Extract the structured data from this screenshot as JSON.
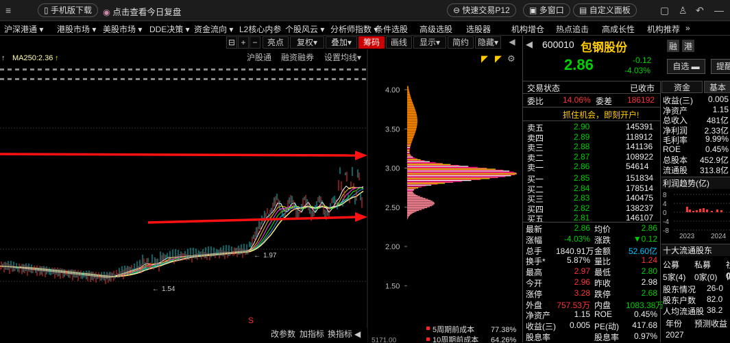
{
  "topbar": {
    "mobile_download": "手机版下载",
    "daily_review": "点击查看今日复盘",
    "quick_trade": "快速交易P12",
    "multi_window": "多窗口",
    "custom_panel": "自定义面板"
  },
  "menu": [
    "沪深港通",
    "港股市场",
    "美股市场",
    "DDE决策",
    "资金流向",
    "L2核心内参",
    "个股风云",
    "分析师指数",
    "条件选股",
    "高级选股",
    "选股器",
    "机构增仓",
    "热点追击",
    "高成长性",
    "机构推荐"
  ],
  "toolbar": {
    "buttons": [
      "亮点",
      "复权",
      "叠加",
      "筹码",
      "画线",
      "显示",
      "简约",
      "隐藏"
    ],
    "active": "筹码"
  },
  "chart": {
    "ma_label": "MA250:2.36",
    "sub_labels": [
      "沪股通",
      "融资融券",
      "设置均线"
    ],
    "price_ticks": [
      "4.00",
      "3.50",
      "3.00",
      "2.50",
      "2.00",
      "1.50"
    ],
    "min_label": "1.54",
    "mid_label": "1.97",
    "bottom_buttons": [
      "改参数",
      "加指标",
      "换指标"
    ],
    "volume_label": "5171.00",
    "cost_legend": [
      {
        "label": "5周期前成本",
        "value": "77.38%"
      },
      {
        "label": "10周期前成本",
        "value": "64.26%"
      }
    ],
    "annotation_color": "#ff1111"
  },
  "stock": {
    "code": "600010",
    "name": "包钢股份",
    "tags": [
      "融",
      "港"
    ],
    "price": "2.86",
    "change": "-0.12",
    "change_pct": "-4.03%",
    "watch_btn": "自选",
    "remind_btn": "提醒",
    "status_label": "交易状态",
    "status_value": "已收市",
    "wb_label": "委比",
    "wb_value": "14.06%",
    "wc_label": "委差",
    "wc_value": "186192",
    "ad_text": "抓住机会，即刻开户!",
    "asks": [
      {
        "label": "卖五",
        "price": "2.90",
        "vol": "145391"
      },
      {
        "label": "卖四",
        "price": "2.89",
        "vol": "118912"
      },
      {
        "label": "卖三",
        "price": "2.88",
        "vol": "141136"
      },
      {
        "label": "卖二",
        "price": "2.87",
        "vol": "108922"
      },
      {
        "label": "卖一",
        "price": "2.86",
        "vol": "54614"
      }
    ],
    "bids": [
      {
        "label": "买一",
        "price": "2.85",
        "vol": "151834"
      },
      {
        "label": "买二",
        "price": "2.84",
        "vol": "178514"
      },
      {
        "label": "买三",
        "price": "2.83",
        "vol": "140475"
      },
      {
        "label": "买四",
        "price": "2.82",
        "vol": "138237"
      },
      {
        "label": "买五",
        "price": "2.81",
        "vol": "146107"
      }
    ],
    "stats": [
      {
        "l1": "最新",
        "v1": "2.86",
        "c1": "green",
        "l2": "均价",
        "v2": "2.86",
        "c2": "green"
      },
      {
        "l1": "涨幅",
        "v1": "-4.03%",
        "c1": "green",
        "l2": "涨跌",
        "v2": "▼0.12",
        "c2": "green"
      },
      {
        "l1": "总手",
        "v1": "1840.91万",
        "c1": "white",
        "l2": "金额",
        "v2": "52.60亿",
        "c2": "cyan"
      },
      {
        "l1": "换手*",
        "v1": "5.87%",
        "c1": "white",
        "l2": "量比",
        "v2": "1.24",
        "c2": "red"
      },
      {
        "l1": "最高",
        "v1": "2.97",
        "c1": "red",
        "l2": "最低",
        "v2": "2.80",
        "c2": "green"
      },
      {
        "l1": "今开",
        "v1": "2.96",
        "c1": "red",
        "l2": "昨收",
        "v2": "2.98",
        "c2": "white"
      },
      {
        "l1": "涨停",
        "v1": "3.28",
        "c1": "red",
        "l2": "跌停",
        "v2": "2.68",
        "c2": "green"
      },
      {
        "l1": "外盘",
        "v1": "757.53万",
        "c1": "red",
        "l2": "内盘",
        "v2": "1083.38万",
        "c2": "green"
      },
      {
        "l1": "净资产",
        "v1": "1.15",
        "c1": "white",
        "l2": "ROE",
        "v2": "0.45%",
        "c2": "white"
      },
      {
        "l1": "收益(三)",
        "v1": "0.005",
        "c1": "white",
        "l2": "PE(动)",
        "v2": "417.68",
        "c2": "white"
      },
      {
        "l1": "股息率",
        "v1": "",
        "c1": "white",
        "l2": "股息率",
        "v2": "0.97%",
        "c2": "white"
      }
    ],
    "side_tabs": [
      "资金",
      "基本"
    ],
    "fundamentals": [
      {
        "label": "收益(三)",
        "value": "0.005"
      },
      {
        "label": "净资产",
        "value": "1.15"
      },
      {
        "label": "总收入",
        "value": "481亿"
      },
      {
        "label": "净利润",
        "value": "2.33亿"
      },
      {
        "label": "毛利率",
        "value": "9.99%"
      },
      {
        "label": "ROE",
        "value": "0.45%"
      },
      {
        "label": "总股本",
        "value": "452.9亿"
      },
      {
        "label": "流通股",
        "value": "313.8亿"
      }
    ],
    "profit_trend_title": "利润趋势(亿)",
    "profit_ticks": [
      "8",
      "4",
      "0",
      "-4",
      "-8"
    ],
    "profit_years": [
      "2023",
      "2024"
    ],
    "holders_title": "十大流通股东",
    "holders_cols": [
      "公募",
      "私募",
      "社保"
    ],
    "holders_vals": [
      "5家(4)",
      "0家(0)",
      "0"
    ],
    "holder_rows": [
      {
        "label": "股东情况",
        "value": "26-0"
      },
      {
        "label": "股东户数",
        "value": "82.0"
      },
      {
        "label": "人均流通股",
        "value": "38.2"
      }
    ],
    "table_cols": [
      "年份",
      "预测收益"
    ],
    "table_year": "2027"
  }
}
